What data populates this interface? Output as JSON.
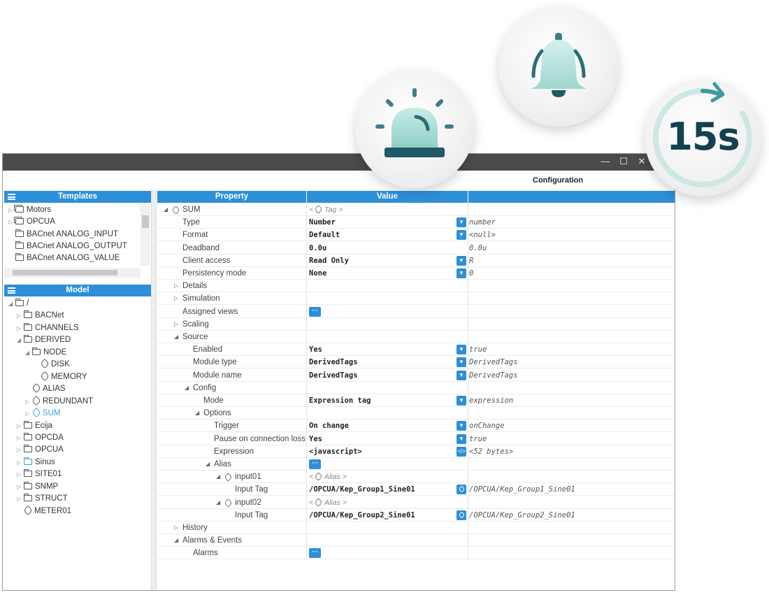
{
  "badges": {
    "beacon_icon": "alarm-beacon-icon",
    "bell_icon": "bell-icon",
    "timer_icon": "timer-icon",
    "timer_text": "15s",
    "colors": {
      "teal_light": "#a9dcd6",
      "teal_dark": "#12414f",
      "grey": "#c9d3d6"
    }
  },
  "window": {
    "title": "Configuration",
    "controls": [
      "—",
      "☐",
      "✕"
    ]
  },
  "templates": {
    "header": "Templates",
    "items": [
      {
        "label": "Motors",
        "icon": "stack-icon",
        "expander": true
      },
      {
        "label": "OPCUA",
        "icon": "stack-icon",
        "expander": true
      },
      {
        "label": "BACnet ANALOG_INPUT",
        "icon": "folder-icon",
        "expander": false
      },
      {
        "label": "BACnet ANALOG_OUTPUT",
        "icon": "folder-icon",
        "expander": false
      },
      {
        "label": "BACnet ANALOG_VALUE",
        "icon": "folder-icon",
        "expander": false
      }
    ]
  },
  "model": {
    "header": "Model",
    "items": [
      {
        "label": "/",
        "icon": "folder",
        "arrow": "◢",
        "indent": 0,
        "selected": false
      },
      {
        "label": "BACNet",
        "icon": "folder",
        "arrow": "▷",
        "indent": 1,
        "selected": false
      },
      {
        "label": "CHANNELS",
        "icon": "folder",
        "arrow": "▷",
        "indent": 1,
        "selected": false
      },
      {
        "label": "DERIVED",
        "icon": "folder",
        "arrow": "◢",
        "indent": 1,
        "selected": false
      },
      {
        "label": "NODE",
        "icon": "folder",
        "arrow": "◢",
        "indent": 2,
        "selected": false
      },
      {
        "label": "DISK",
        "icon": "tag",
        "arrow": "",
        "indent": 3,
        "selected": false
      },
      {
        "label": "MEMORY",
        "icon": "tag",
        "arrow": "",
        "indent": 3,
        "selected": false
      },
      {
        "label": "ALIAS",
        "icon": "tag",
        "arrow": "",
        "indent": 2,
        "selected": false
      },
      {
        "label": "REDUNDANT",
        "icon": "tag",
        "arrow": "▷",
        "indent": 2,
        "selected": false
      },
      {
        "label": "SUM",
        "icon": "tag",
        "arrow": "▷",
        "indent": 2,
        "selected": true
      },
      {
        "label": "Ecija",
        "icon": "folder",
        "arrow": "▷",
        "indent": 1,
        "selected": false
      },
      {
        "label": "OPCDA",
        "icon": "folder",
        "arrow": "▷",
        "indent": 1,
        "selected": false
      },
      {
        "label": "OPCUA",
        "icon": "folder",
        "arrow": "▷",
        "indent": 1,
        "selected": false
      },
      {
        "label": "Sinus",
        "icon": "folder-blue",
        "arrow": "▷",
        "indent": 1,
        "selected": false
      },
      {
        "label": "SITE01",
        "icon": "folder",
        "arrow": "▷",
        "indent": 1,
        "selected": false
      },
      {
        "label": "SNMP",
        "icon": "folder",
        "arrow": "▷",
        "indent": 1,
        "selected": false
      },
      {
        "label": "STRUCT",
        "icon": "folder",
        "arrow": "▷",
        "indent": 1,
        "selected": false
      },
      {
        "label": "METER01",
        "icon": "tag",
        "arrow": "",
        "indent": 1,
        "selected": false
      }
    ]
  },
  "grid": {
    "headers": {
      "property": "Property",
      "value": "Value",
      "raw": ""
    },
    "rows": [
      {
        "label": "SUM",
        "indent": 0,
        "arrow": "◢",
        "tagicon": true,
        "value": "Tag",
        "value_style": "hint-tag",
        "control": "",
        "raw": ""
      },
      {
        "label": "Type",
        "indent": 1,
        "arrow": "",
        "value": "Number",
        "control": "drop",
        "raw": "number"
      },
      {
        "label": "Format",
        "indent": 1,
        "arrow": "",
        "value": "Default",
        "control": "drop",
        "raw": "<null>"
      },
      {
        "label": "Deadband",
        "indent": 1,
        "arrow": "",
        "value": "0.0u",
        "control": "",
        "raw": "0.0u"
      },
      {
        "label": "Client access",
        "indent": 1,
        "arrow": "",
        "value": "Read Only",
        "control": "drop",
        "raw": "R"
      },
      {
        "label": "Persistency mode",
        "indent": 1,
        "arrow": "",
        "value": "None",
        "control": "drop",
        "raw": "0"
      },
      {
        "label": "Details",
        "indent": 1,
        "arrow": "▷",
        "value": "",
        "control": "",
        "raw": ""
      },
      {
        "label": "Simulation",
        "indent": 1,
        "arrow": "▷",
        "value": "",
        "control": "",
        "raw": ""
      },
      {
        "label": "Assigned views",
        "indent": 1,
        "arrow": "",
        "value": "",
        "control": "dots",
        "raw": ""
      },
      {
        "label": "Scaling",
        "indent": 1,
        "arrow": "▷",
        "value": "",
        "control": "",
        "raw": ""
      },
      {
        "label": "Source",
        "indent": 1,
        "arrow": "◢",
        "value": "",
        "control": "",
        "raw": ""
      },
      {
        "label": "Enabled",
        "indent": 2,
        "arrow": "",
        "value": "Yes",
        "control": "drop",
        "raw": "true"
      },
      {
        "label": "Module type",
        "indent": 2,
        "arrow": "",
        "value": "DerivedTags",
        "control": "drop",
        "raw": "DerivedTags"
      },
      {
        "label": "Module name",
        "indent": 2,
        "arrow": "",
        "value": "DerivedTags",
        "control": "drop",
        "raw": "DerivedTags"
      },
      {
        "label": "Config",
        "indent": 2,
        "arrow": "◢",
        "value": "",
        "control": "",
        "raw": ""
      },
      {
        "label": "Mode",
        "indent": 3,
        "arrow": "",
        "value": "Expression tag",
        "control": "drop",
        "raw": "expression"
      },
      {
        "label": "Options",
        "indent": 3,
        "arrow": "◢",
        "value": "",
        "control": "",
        "raw": ""
      },
      {
        "label": "Trigger",
        "indent": 4,
        "arrow": "",
        "value": "On change",
        "control": "drop",
        "raw": "onChange"
      },
      {
        "label": "Pause on connection loss",
        "indent": 4,
        "arrow": "",
        "value": "Yes",
        "control": "drop",
        "raw": "true"
      },
      {
        "label": "Expression",
        "indent": 4,
        "arrow": "",
        "value": "<javascript>",
        "control": "code",
        "raw": "<52 bytes>"
      },
      {
        "label": "Alias",
        "indent": 4,
        "arrow": "◢",
        "value": "",
        "control": "dots",
        "raw": ""
      },
      {
        "label": "input01",
        "indent": 5,
        "arrow": "◢",
        "tagicon": true,
        "value": "Alias",
        "value_style": "hint-tag",
        "control": "",
        "raw": ""
      },
      {
        "label": "Input Tag",
        "indent": 6,
        "arrow": "",
        "value": "/OPCUA/Kep_Group1_Sine01",
        "control": "tag",
        "raw": "/OPCUA/Kep_Group1_Sine01"
      },
      {
        "label": "input02",
        "indent": 5,
        "arrow": "◢",
        "tagicon": true,
        "value": "Alias",
        "value_style": "hint-tag",
        "control": "",
        "raw": ""
      },
      {
        "label": "Input Tag",
        "indent": 6,
        "arrow": "",
        "value": "/OPCUA/Kep_Group2_Sine01",
        "control": "tag",
        "raw": "/OPCUA/Kep_Group2_Sine01"
      },
      {
        "label": "History",
        "indent": 1,
        "arrow": "▷",
        "value": "",
        "control": "",
        "raw": ""
      },
      {
        "label": "Alarms & Events",
        "indent": 1,
        "arrow": "◢",
        "value": "",
        "control": "",
        "raw": ""
      },
      {
        "label": "Alarms",
        "indent": 2,
        "arrow": "",
        "value": "",
        "control": "dots",
        "raw": ""
      }
    ]
  }
}
